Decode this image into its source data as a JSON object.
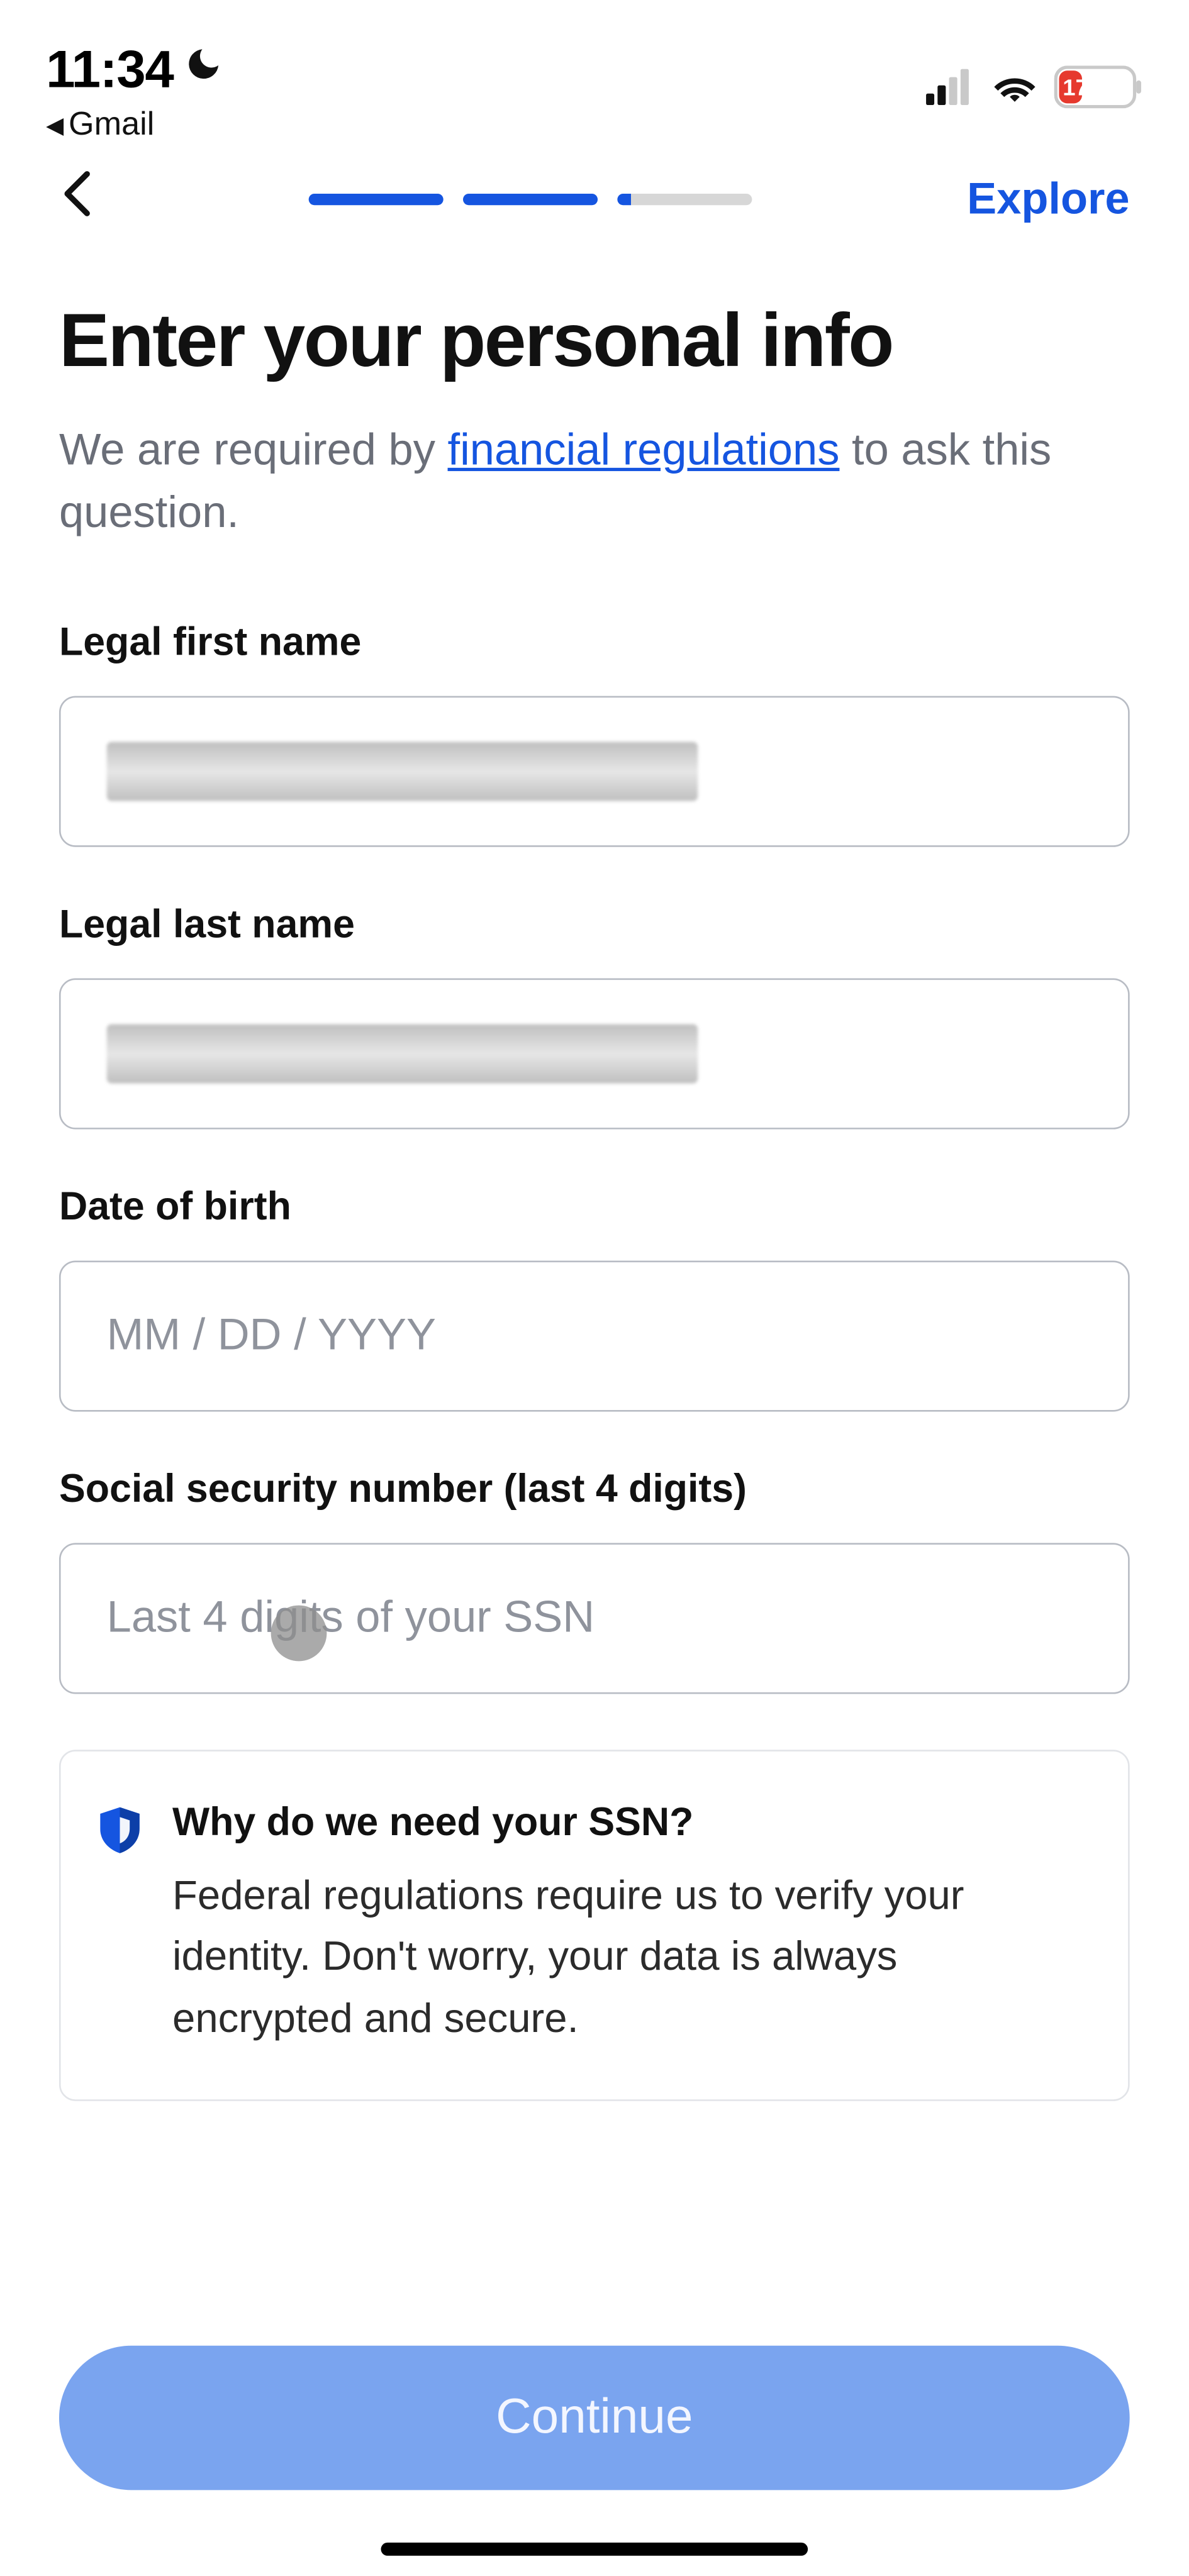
{
  "status": {
    "time": "11:34",
    "back_app": "Gmail",
    "battery": "17"
  },
  "header": {
    "explore": "Explore"
  },
  "page": {
    "title": "Enter your personal info",
    "subtitle_pre": "We are required by ",
    "subtitle_link": "financial regulations",
    "subtitle_post": " to ask this question."
  },
  "form": {
    "first_name": {
      "label": "Legal first name",
      "value": ""
    },
    "last_name": {
      "label": "Legal last name",
      "value": ""
    },
    "dob": {
      "label": "Date of birth",
      "placeholder": "MM / DD / YYYY"
    },
    "ssn": {
      "label": "Social security number (last 4 digits)",
      "placeholder": "Last 4 digits of your SSN"
    }
  },
  "info": {
    "title": "Why do we need your SSN?",
    "body": "Federal regulations require us to verify your identity. Don't worry, your data is always encrypted and secure."
  },
  "cta": {
    "continue": "Continue"
  }
}
